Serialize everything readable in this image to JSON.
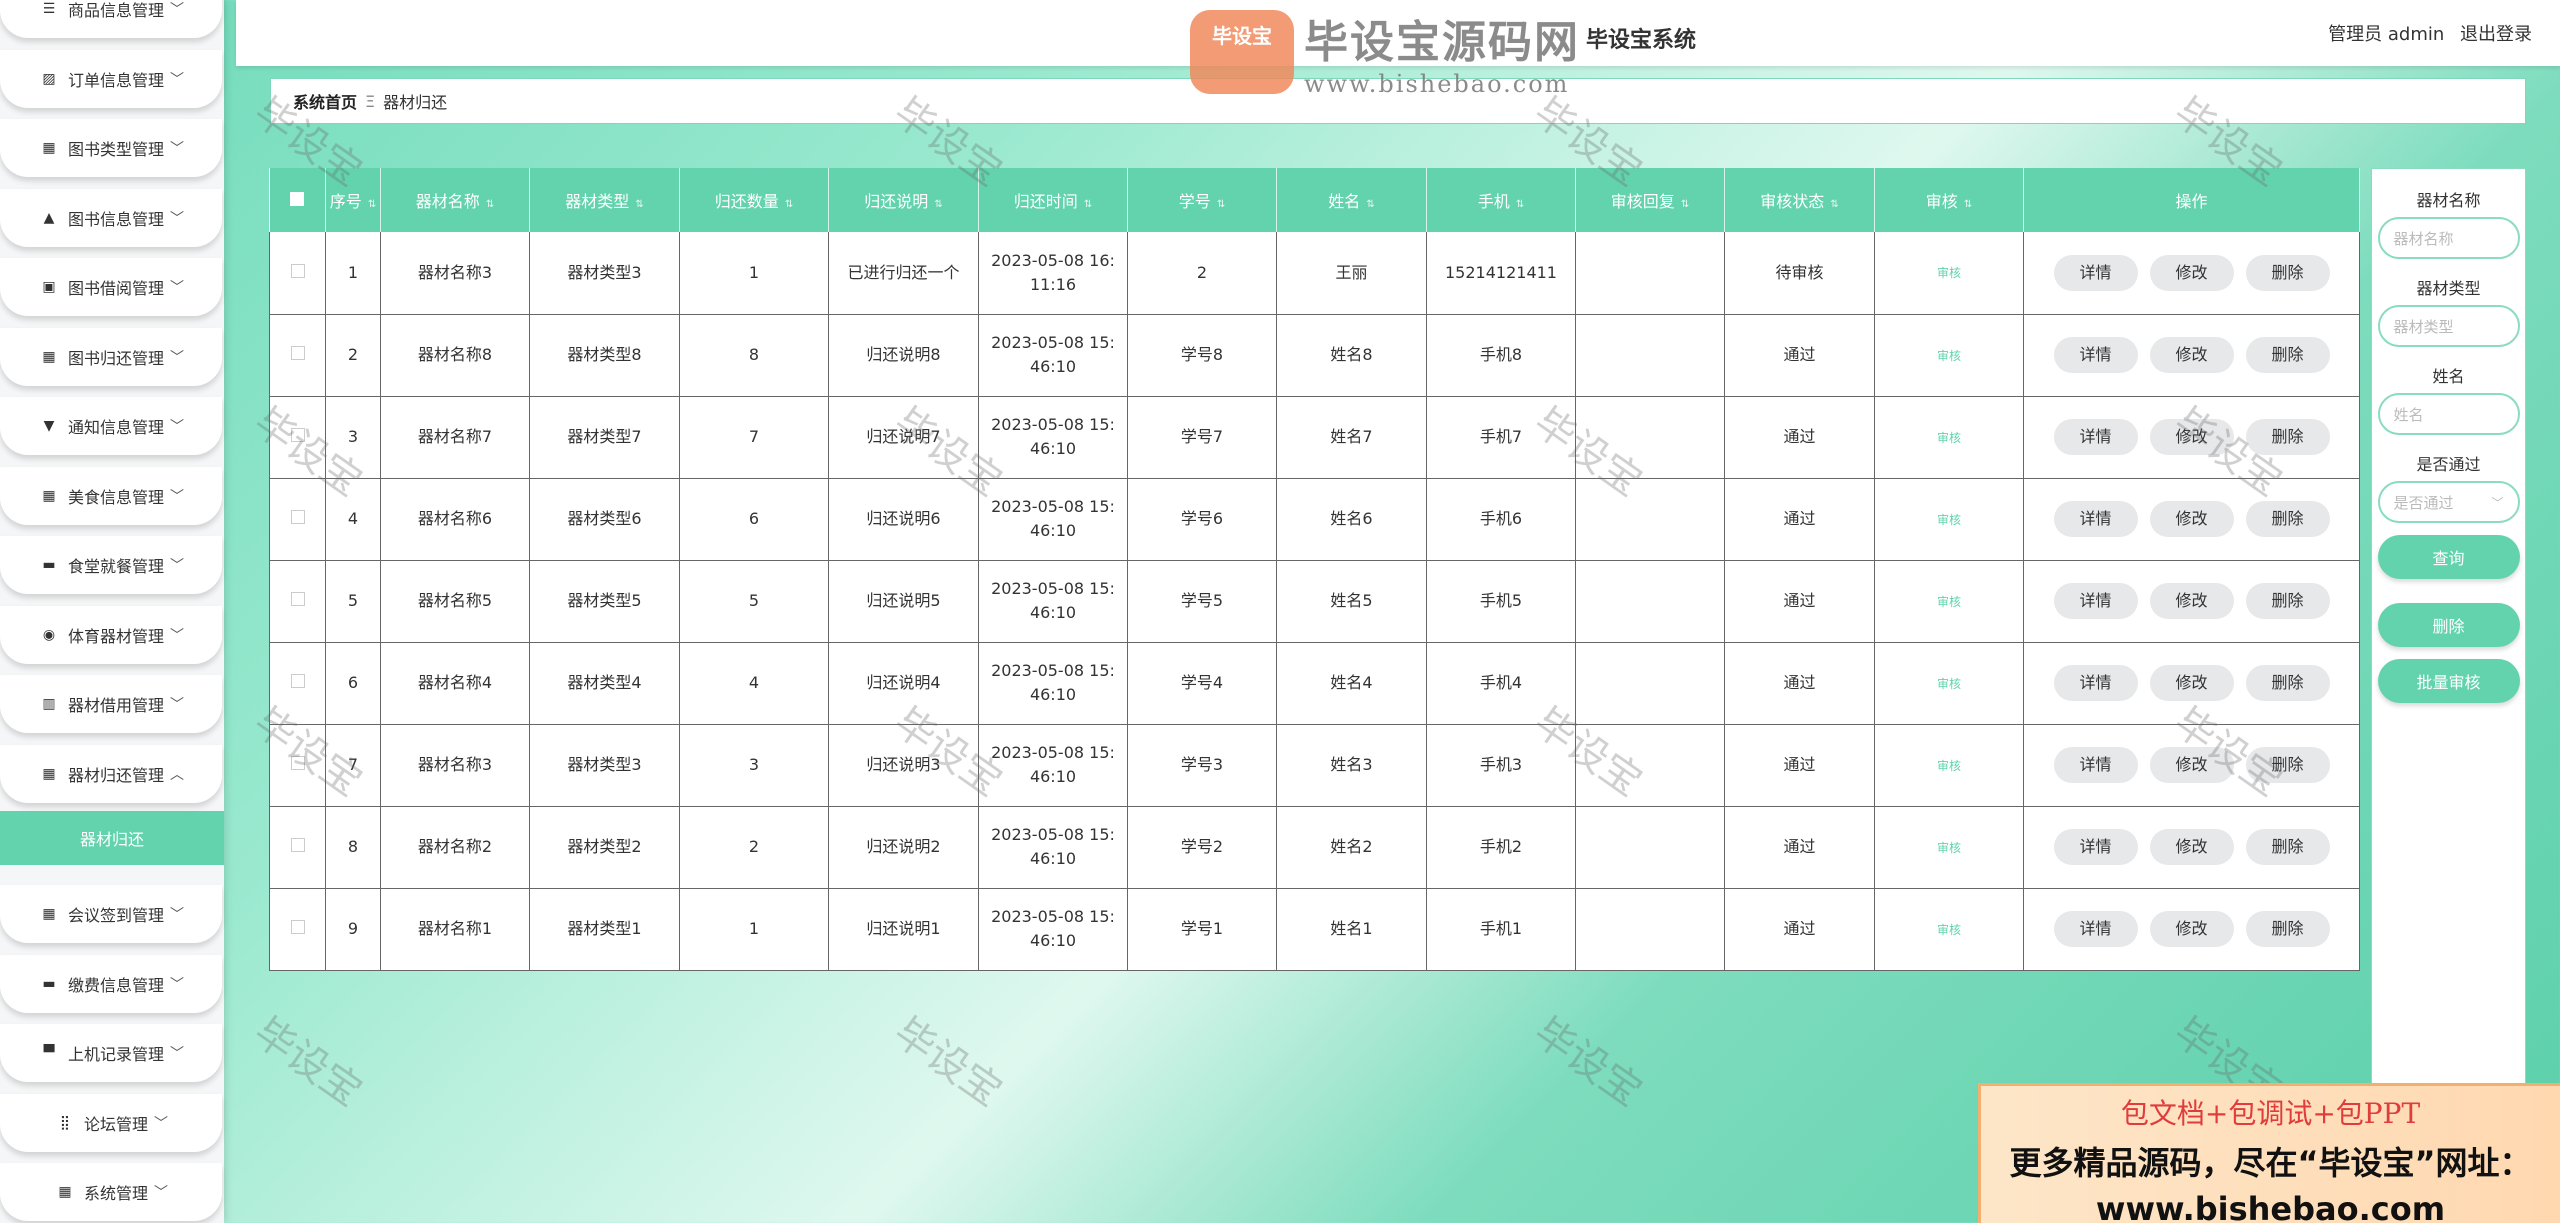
{
  "sidebar": {
    "menus": [
      {
        "label": "商品信息管理",
        "icon": "list-icon",
        "glyph": "☰",
        "chevron": "﹀"
      },
      {
        "label": "订单信息管理",
        "icon": "chart-icon",
        "glyph": "▨",
        "chevron": "﹀"
      },
      {
        "label": "图书类型管理",
        "icon": "grid-icon",
        "glyph": "▦",
        "chevron": "﹀"
      },
      {
        "label": "图书信息管理",
        "icon": "user-icon",
        "glyph": "▲",
        "chevron": "﹀"
      },
      {
        "label": "图书借阅管理",
        "icon": "clipboard-icon",
        "glyph": "▣",
        "chevron": "﹀"
      },
      {
        "label": "图书归还管理",
        "icon": "grid-icon",
        "glyph": "▦",
        "chevron": "﹀"
      },
      {
        "label": "通知信息管理",
        "icon": "pin-icon",
        "glyph": "▼",
        "chevron": "﹀"
      },
      {
        "label": "美食信息管理",
        "icon": "grid-icon",
        "glyph": "▦",
        "chevron": "﹀"
      },
      {
        "label": "食堂就餐管理",
        "icon": "chat-icon",
        "glyph": "▬",
        "chevron": "﹀"
      },
      {
        "label": "体育器材管理",
        "icon": "drop-icon",
        "glyph": "◉",
        "chevron": "﹀"
      },
      {
        "label": "器材借用管理",
        "icon": "books-icon",
        "glyph": "▥",
        "chevron": "﹀"
      },
      {
        "label": "器材归还管理",
        "icon": "grid-icon",
        "glyph": "▦",
        "chevron": "︿"
      },
      {
        "label": "会议签到管理",
        "icon": "grid-icon",
        "glyph": "▦",
        "chevron": "﹀"
      },
      {
        "label": "缴费信息管理",
        "icon": "card-icon",
        "glyph": "▬",
        "chevron": "﹀"
      },
      {
        "label": "上机记录管理",
        "icon": "monitor-icon",
        "glyph": "▀",
        "chevron": "﹀"
      },
      {
        "label": "论坛管理",
        "icon": "apps-icon",
        "glyph": "⣿",
        "chevron": "﹀"
      },
      {
        "label": "系统管理",
        "icon": "grid-icon",
        "glyph": "▦",
        "chevron": "﹀"
      }
    ],
    "active_sub": "器材归还"
  },
  "header": {
    "title": "毕设宝系统",
    "user": "管理员 admin",
    "logout": "退出登录"
  },
  "breadcrumb": {
    "home": "系统首页",
    "sep": "Ξ",
    "current": "器材归还"
  },
  "table": {
    "headers": [
      "序号",
      "器材名称",
      "器材类型",
      "归还数量",
      "归还说明",
      "归还时间",
      "学号",
      "姓名",
      "手机",
      "审核回复",
      "审核状态",
      "审核",
      "操作"
    ],
    "audit_link": "审核",
    "ops": {
      "detail": "详情",
      "edit": "修改",
      "delete": "删除"
    },
    "rows": [
      {
        "no": "1",
        "name": "器材名称3",
        "type": "器材类型3",
        "qty": "1",
        "note": "已进行归还一个",
        "time": "2023-05-08 16:11:16",
        "sid": "2",
        "sname": "王丽",
        "phone": "15214121411",
        "reply": "",
        "status": "待审核"
      },
      {
        "no": "2",
        "name": "器材名称8",
        "type": "器材类型8",
        "qty": "8",
        "note": "归还说明8",
        "time": "2023-05-08 15:46:10",
        "sid": "学号8",
        "sname": "姓名8",
        "phone": "手机8",
        "reply": "",
        "status": "通过"
      },
      {
        "no": "3",
        "name": "器材名称7",
        "type": "器材类型7",
        "qty": "7",
        "note": "归还说明7",
        "time": "2023-05-08 15:46:10",
        "sid": "学号7",
        "sname": "姓名7",
        "phone": "手机7",
        "reply": "",
        "status": "通过"
      },
      {
        "no": "4",
        "name": "器材名称6",
        "type": "器材类型6",
        "qty": "6",
        "note": "归还说明6",
        "time": "2023-05-08 15:46:10",
        "sid": "学号6",
        "sname": "姓名6",
        "phone": "手机6",
        "reply": "",
        "status": "通过"
      },
      {
        "no": "5",
        "name": "器材名称5",
        "type": "器材类型5",
        "qty": "5",
        "note": "归还说明5",
        "time": "2023-05-08 15:46:10",
        "sid": "学号5",
        "sname": "姓名5",
        "phone": "手机5",
        "reply": "",
        "status": "通过"
      },
      {
        "no": "6",
        "name": "器材名称4",
        "type": "器材类型4",
        "qty": "4",
        "note": "归还说明4",
        "time": "2023-05-08 15:46:10",
        "sid": "学号4",
        "sname": "姓名4",
        "phone": "手机4",
        "reply": "",
        "status": "通过"
      },
      {
        "no": "7",
        "name": "器材名称3",
        "type": "器材类型3",
        "qty": "3",
        "note": "归还说明3",
        "time": "2023-05-08 15:46:10",
        "sid": "学号3",
        "sname": "姓名3",
        "phone": "手机3",
        "reply": "",
        "status": "通过"
      },
      {
        "no": "8",
        "name": "器材名称2",
        "type": "器材类型2",
        "qty": "2",
        "note": "归还说明2",
        "time": "2023-05-08 15:46:10",
        "sid": "学号2",
        "sname": "姓名2",
        "phone": "手机2",
        "reply": "",
        "status": "通过"
      },
      {
        "no": "9",
        "name": "器材名称1",
        "type": "器材类型1",
        "qty": "1",
        "note": "归还说明1",
        "time": "2023-05-08 15:46:10",
        "sid": "学号1",
        "sname": "姓名1",
        "phone": "手机1",
        "reply": "",
        "status": "通过"
      }
    ]
  },
  "search": {
    "name_label": "器材名称",
    "name_placeholder": "器材名称",
    "type_label": "器材类型",
    "type_placeholder": "器材类型",
    "person_label": "姓名",
    "person_placeholder": "姓名",
    "pass_label": "是否通过",
    "pass_placeholder": "是否通过",
    "query_btn": "查询",
    "delete_btn": "删除",
    "batch_btn": "批量审核"
  },
  "watermark": {
    "text": "毕设宝",
    "logo_badge": "毕设宝",
    "logo_main": "毕设宝源码网",
    "logo_url": "www.bishebao.com",
    "ad_line1": "包文档+包调试+包PPT",
    "ad_line2": "更多精品源码，尽在“毕设宝”网址：",
    "ad_line3": "www.bishebao.com"
  },
  "colors": {
    "accent": "#63d3ad"
  }
}
